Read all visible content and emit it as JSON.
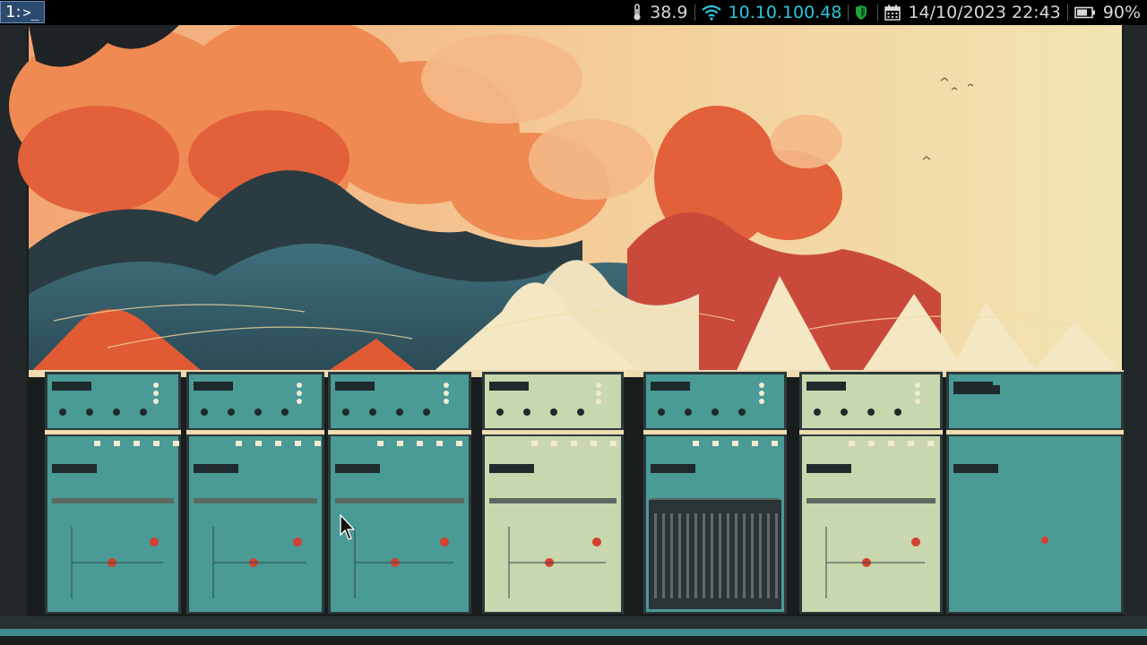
{
  "workspace": {
    "number": "1:",
    "icon": "terminal-icon"
  },
  "status": {
    "temperature": "38.9",
    "temperature_icon": "thermometer-icon",
    "network_ip": "10.10.100.48",
    "network_icon": "wifi-icon",
    "network_color": "#2bc7d8",
    "vpn_icon": "shield-icon",
    "vpn_color": "#1fa53a",
    "datetime": "14/10/2023 22:43",
    "datetime_icon": "calendar-icon",
    "battery": "90%",
    "battery_icon": "battery-icon"
  },
  "wallpaper": {
    "subject": "retro-computer-racks-under-ocean-waves",
    "palette": [
      "#f6e6b4",
      "#f08b55",
      "#e25a35",
      "#3a6e78",
      "#4a9a96",
      "#c9d7ae",
      "#222"
    ]
  }
}
